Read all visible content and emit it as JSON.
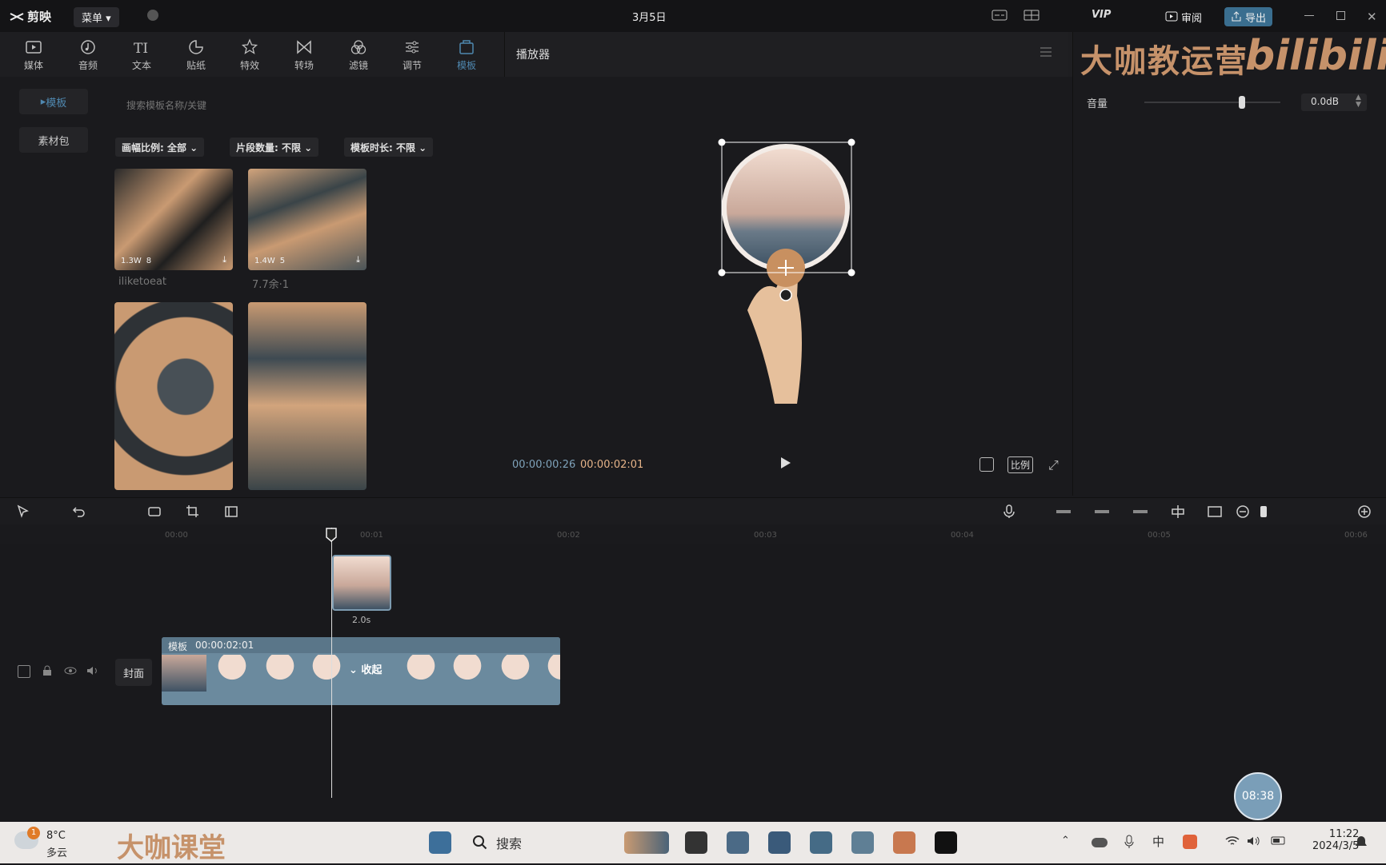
{
  "app": {
    "name": "剪映",
    "menu": "菜单",
    "date": "3月5日",
    "review": "审阅",
    "export": "导出"
  },
  "toolbar": {
    "tools": [
      {
        "label": "媒体"
      },
      {
        "label": "音频"
      },
      {
        "label": "文本"
      },
      {
        "label": "贴纸"
      },
      {
        "label": "特效"
      },
      {
        "label": "转场"
      },
      {
        "label": "滤镜"
      },
      {
        "label": "调节"
      },
      {
        "label": "模板"
      }
    ]
  },
  "player": {
    "title": "播放器",
    "current_time": "00:00:00:26",
    "total_time": "00:00:02:01",
    "ratio_label": "比例"
  },
  "watermark": {
    "text": "大咖教运营",
    "brand": "bilibili"
  },
  "right_panel": {
    "volume_label": "音量",
    "volume_value": "0.0dB",
    "volume_level": 0.72
  },
  "left_nav": {
    "templates": "模板",
    "material_pack": "素材包"
  },
  "search": {
    "placeholder": "搜索模板名称/关键"
  },
  "filters": [
    {
      "label": "画幅比例: 全部"
    },
    {
      "label": "片段数量: 不限"
    },
    {
      "label": "模板时长: 不限"
    }
  ],
  "cards": [
    {
      "name": "iliketoeat",
      "meta_a": "1.3W",
      "meta_b": "8"
    },
    {
      "name": "7.7余·1",
      "meta_a": "1.4W",
      "meta_b": "5"
    },
    {
      "name": "",
      "meta_a": "",
      "meta_b": ""
    },
    {
      "name": "",
      "meta_a": "",
      "meta_b": ""
    }
  ],
  "timeline": {
    "ticks": [
      "00:00",
      "00:01",
      "00:02",
      "00:03",
      "00:04",
      "00:05",
      "00:06"
    ],
    "small_clip_duration": "2.0s",
    "main_clip_label": "模板",
    "main_clip_time": "00:00:02:01",
    "collapse": "收起",
    "cover": "封面"
  },
  "recording_timer": "08:38",
  "taskbar": {
    "temp": "8°C",
    "weather": "多云",
    "badge": "1",
    "logo": "大咖课堂",
    "search": "搜索",
    "time": "11:22",
    "date": "2024/3/5",
    "ime": "中"
  }
}
